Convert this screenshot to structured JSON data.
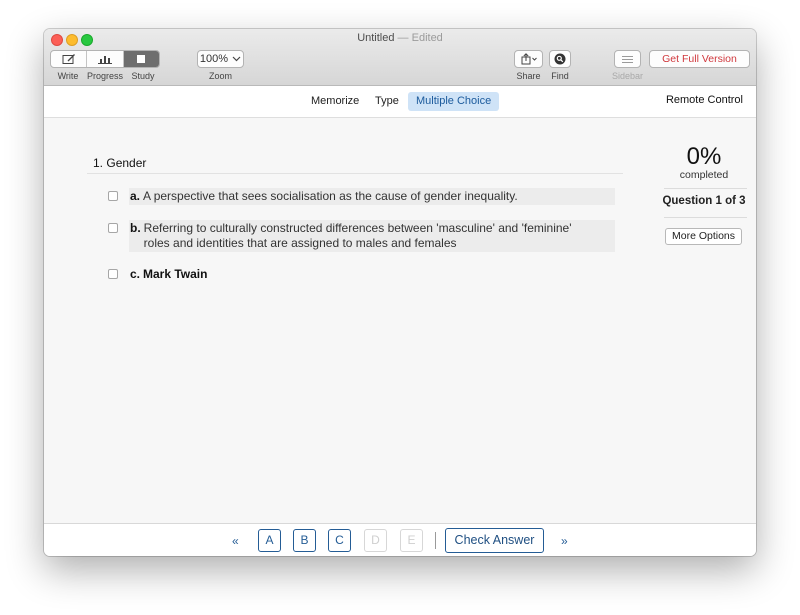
{
  "window": {
    "title": "Untitled",
    "title_separator": "—",
    "title_status": "Edited"
  },
  "toolbar": {
    "view_segments": [
      {
        "label": "Write",
        "icon": "pencil-square-icon",
        "active": false
      },
      {
        "label": "Progress",
        "icon": "bar-chart-icon",
        "active": false
      },
      {
        "label": "Study",
        "icon": "stop-square-icon",
        "active": true
      }
    ],
    "zoom": {
      "value": "100%",
      "label": "Zoom"
    },
    "share": {
      "label": "Share",
      "icon": "share-icon"
    },
    "find": {
      "label": "Find",
      "icon": "search-icon"
    },
    "sidebar": {
      "label": "Sidebar",
      "icon": "list-lines-icon",
      "enabled": false
    },
    "get_full_version": "Get Full Version"
  },
  "mode_tabs": [
    {
      "label": "Memorize",
      "active": false
    },
    {
      "label": "Type",
      "active": false
    },
    {
      "label": "Multiple Choice",
      "active": true
    }
  ],
  "remote_control": "Remote Control",
  "question": {
    "number": "1.",
    "title": "Gender",
    "answers": [
      {
        "letter": "a.",
        "text": "A perspective that sees socialisation as the cause of gender inequality.",
        "checked": false
      },
      {
        "letter": "b.",
        "text": "Referring to culturally constructed differences between 'masculine' and 'feminine' roles and identities that are assigned to males and females",
        "checked": false
      },
      {
        "letter": "c.",
        "text": "Mark Twain",
        "checked": false
      }
    ]
  },
  "progress": {
    "percent": "0%",
    "percent_label": "completed",
    "question_counter": "Question 1 of 3",
    "more_options": "More Options"
  },
  "bottom_bar": {
    "prev": "«",
    "choices": [
      {
        "label": "A",
        "enabled": true
      },
      {
        "label": "B",
        "enabled": true
      },
      {
        "label": "C",
        "enabled": true
      },
      {
        "label": "D",
        "enabled": false
      },
      {
        "label": "E",
        "enabled": false
      }
    ],
    "check_answer": "Check Answer",
    "next": "»"
  },
  "colors": {
    "accent": "#245c95",
    "active_tab_bg": "#cfe3f7",
    "get_full_version": "#d0383d"
  }
}
